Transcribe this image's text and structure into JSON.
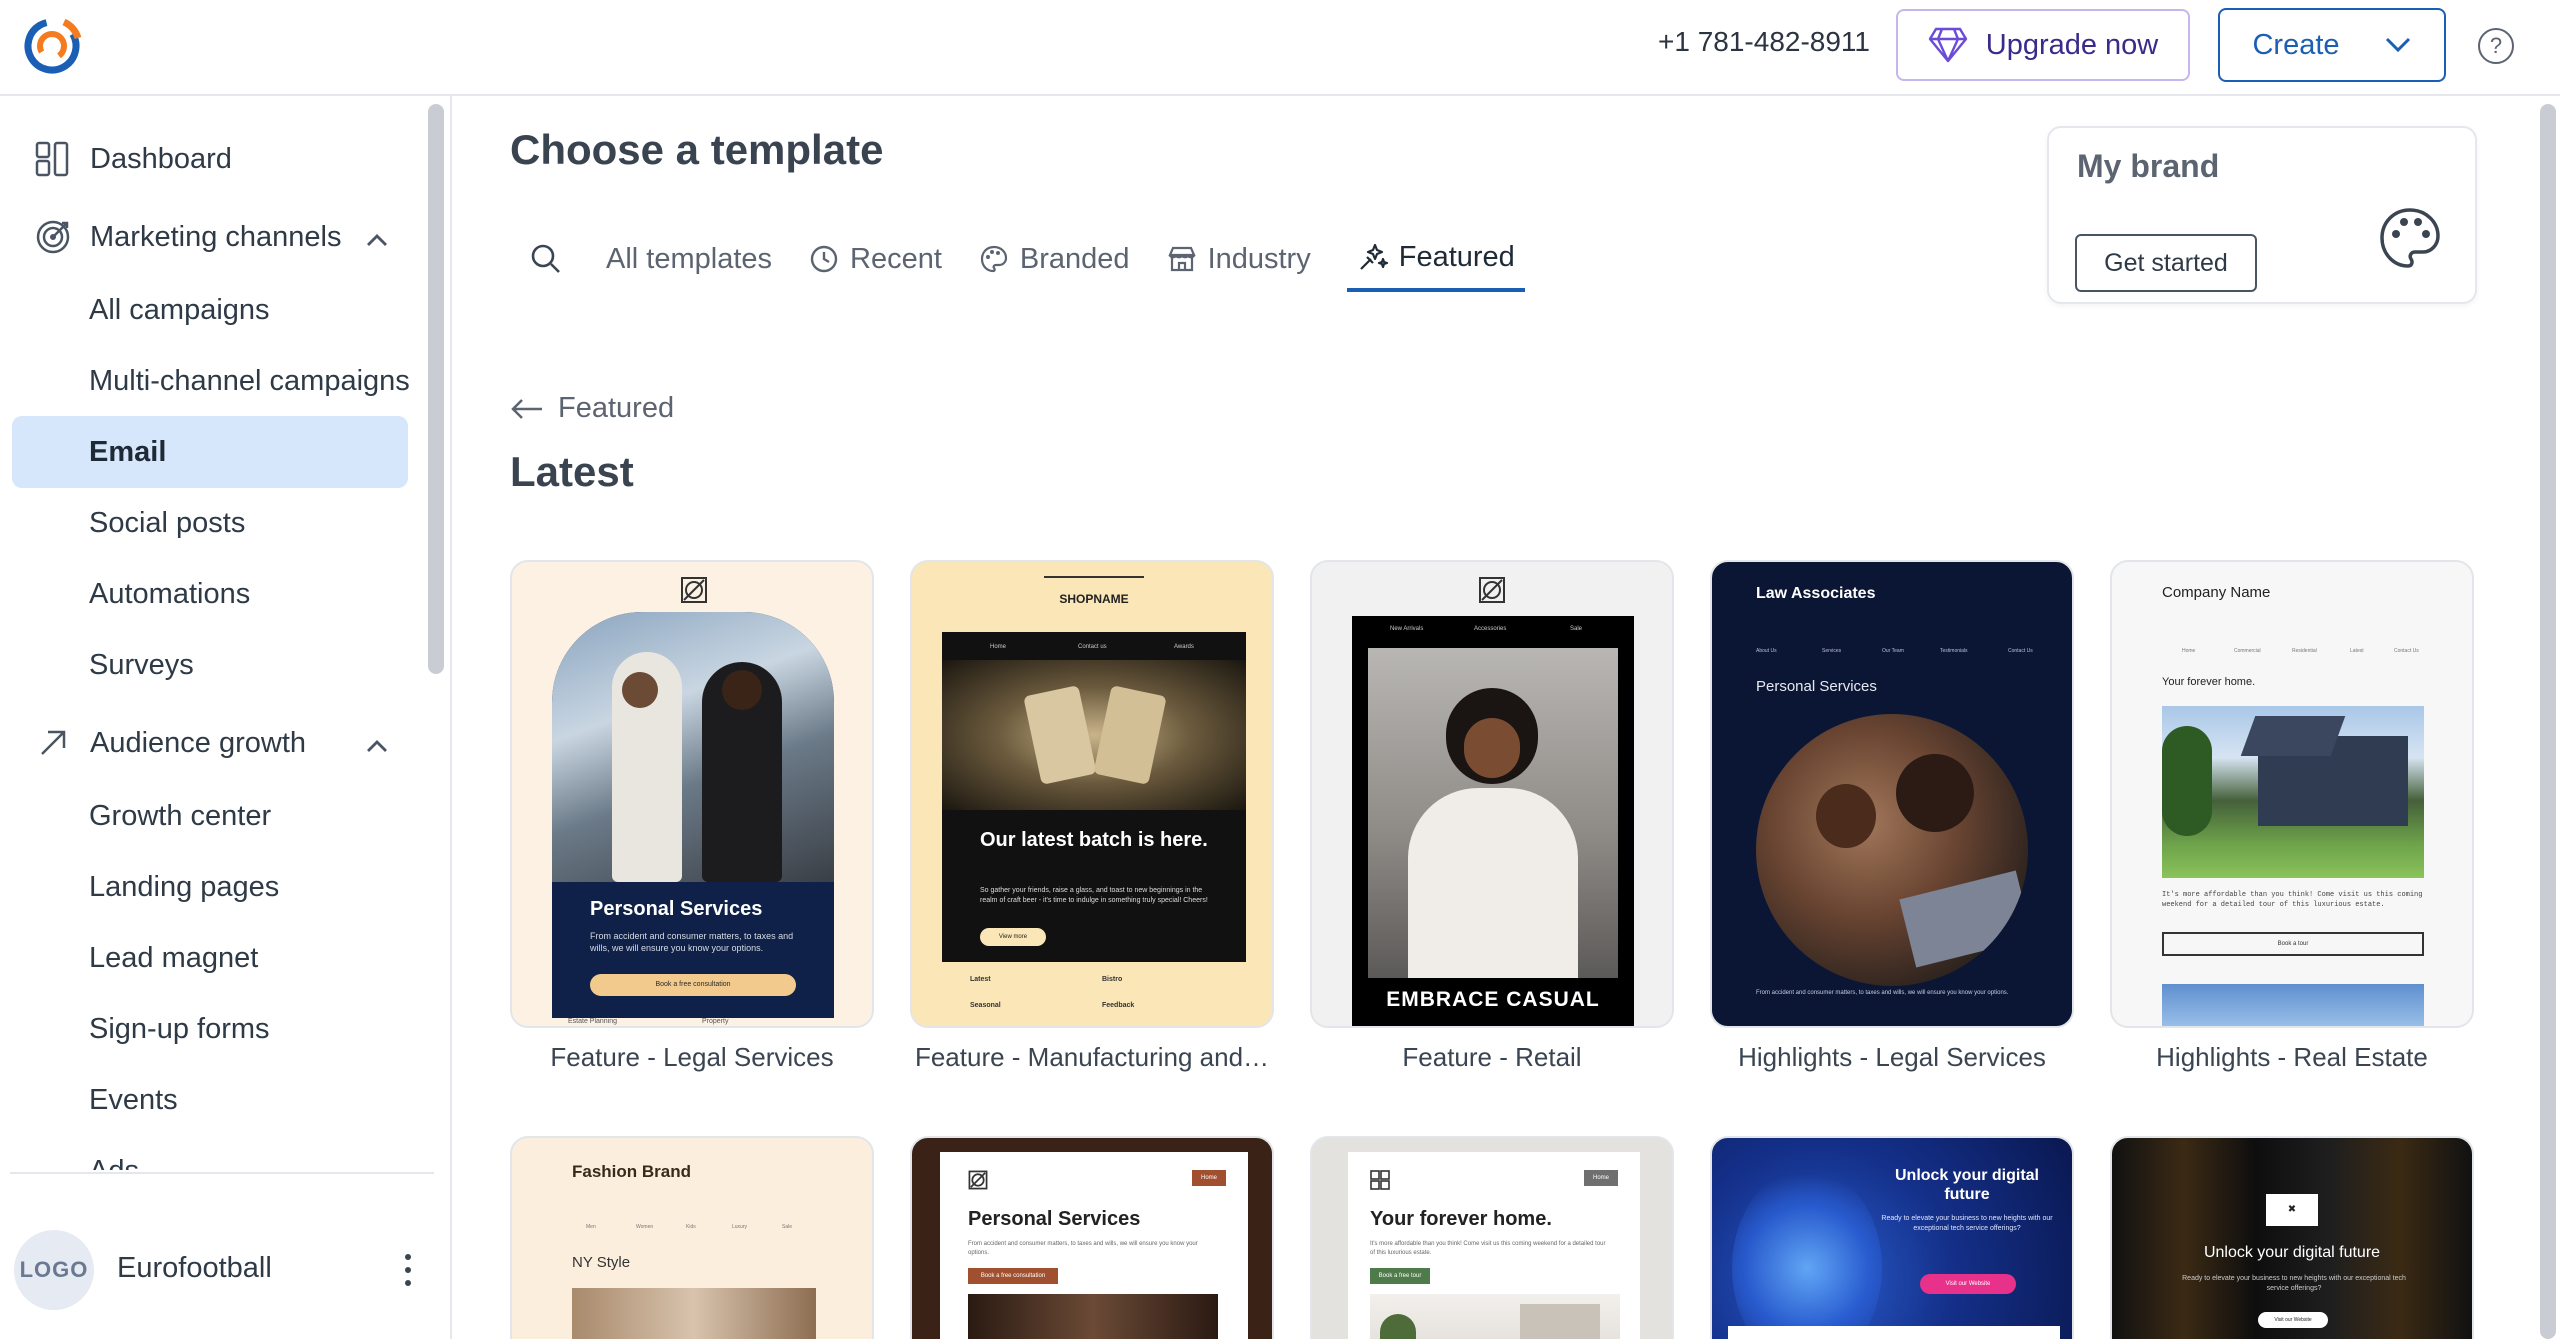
{
  "header": {
    "phone": "+1 781-482-8911",
    "upgrade_label": "Upgrade now",
    "create_label": "Create",
    "help_glyph": "?"
  },
  "sidebar": {
    "items": [
      {
        "label": "Dashboard",
        "icon": "dashboard-icon"
      },
      {
        "label": "Marketing channels",
        "icon": "target-icon"
      },
      {
        "label": "Audience growth",
        "icon": "arrow-up-right-icon"
      }
    ],
    "marketing_sub": [
      "All campaigns",
      "Multi-channel campaigns",
      "Email",
      "Social posts",
      "Automations",
      "Surveys"
    ],
    "audience_sub": [
      "Growth center",
      "Landing pages",
      "Lead magnet",
      "Sign-up forms",
      "Events",
      "Ads"
    ],
    "active_item": "Email",
    "account": {
      "logo": "LOGO",
      "name": "Eurofootball"
    }
  },
  "main": {
    "title": "Choose a template",
    "tabs": [
      {
        "label": "All templates",
        "icon": ""
      },
      {
        "label": "Recent",
        "icon": "clock-icon"
      },
      {
        "label": "Branded",
        "icon": "palette-icon"
      },
      {
        "label": "Industry",
        "icon": "store-icon"
      },
      {
        "label": "Featured",
        "icon": "sparkle-icon"
      }
    ],
    "active_tab": "Featured",
    "brand": {
      "title": "My brand",
      "button": "Get started"
    },
    "back_label": "Featured",
    "section_title": "Latest",
    "templates": [
      {
        "label": "Feature - Legal Services",
        "headline": "Personal Services",
        "body": "From accident and consumer matters, to taxes and wills, we will ensure you know your options.",
        "cta": "Book a free consultation",
        "footer_left": "Estate Planning",
        "footer_right": "Property"
      },
      {
        "label": "Feature - Manufacturing and…",
        "brand": "SHOPNAME",
        "nav": [
          "Home",
          "Contact us",
          "Awards"
        ],
        "headline": "Our latest batch is here.",
        "body": "So gather your friends, raise a glass, and toast to new beginnings in the realm of craft beer - it's time to indulge in something truly special! Cheers!",
        "cta": "View more",
        "links": [
          "Latest",
          "Bistro",
          "Seasonal",
          "Feedback"
        ]
      },
      {
        "label": "Feature - Retail",
        "nav": [
          "New Arrivals",
          "Accessories",
          "Sale"
        ],
        "headline": "EMBRACE CASUAL"
      },
      {
        "label": "Highlights - Legal Services",
        "brand": "Law Associates",
        "nav": [
          "About Us",
          "Services",
          "Our Team",
          "Testimonials",
          "Contact Us"
        ],
        "headline": "Personal Services",
        "body": "From accident and consumer matters, to taxes and wills, we will ensure you know your options."
      },
      {
        "label": "Highlights - Real Estate",
        "brand": "Company Name",
        "nav": [
          "Home",
          "Commercial",
          "Residential",
          "Latest",
          "Contact Us"
        ],
        "headline": "Your forever home.",
        "body": "It's more affordable than you think! Come visit us this coming weekend for a detailed tour of this luxurious estate.",
        "cta": "Book a tour"
      }
    ],
    "templates_row2": [
      {
        "brand": "Fashion Brand",
        "nav": [
          "Men",
          "Women",
          "Kids",
          "Luxury",
          "Sale"
        ],
        "headline": "NY Style"
      },
      {
        "headline": "Personal Services",
        "tag": "Home",
        "body": "From accident and consumer matters, to taxes and wills, we will ensure you know your options.",
        "cta": "Book a free consultation"
      },
      {
        "headline": "Your forever home.",
        "tag": "Home",
        "body": "It's more affordable than you think! Come visit us this coming weekend for a detailed tour of this luxurious estate.",
        "cta": "Book a free tour"
      },
      {
        "headline": "Unlock your digital future",
        "body": "Ready to elevate your business to new heights with our exceptional tech service offerings?",
        "cta": "Visit our Website"
      },
      {
        "headline": "Unlock your digital future",
        "body": "Ready to elevate your business to new heights with our exceptional tech service offerings?",
        "cta": "Visit our Website",
        "tag": "✖"
      }
    ]
  },
  "colors": {
    "accent": "#1a5fb4",
    "upgrade_border": "#c6b6ef",
    "active_nav_bg": "#d6e6fb"
  }
}
